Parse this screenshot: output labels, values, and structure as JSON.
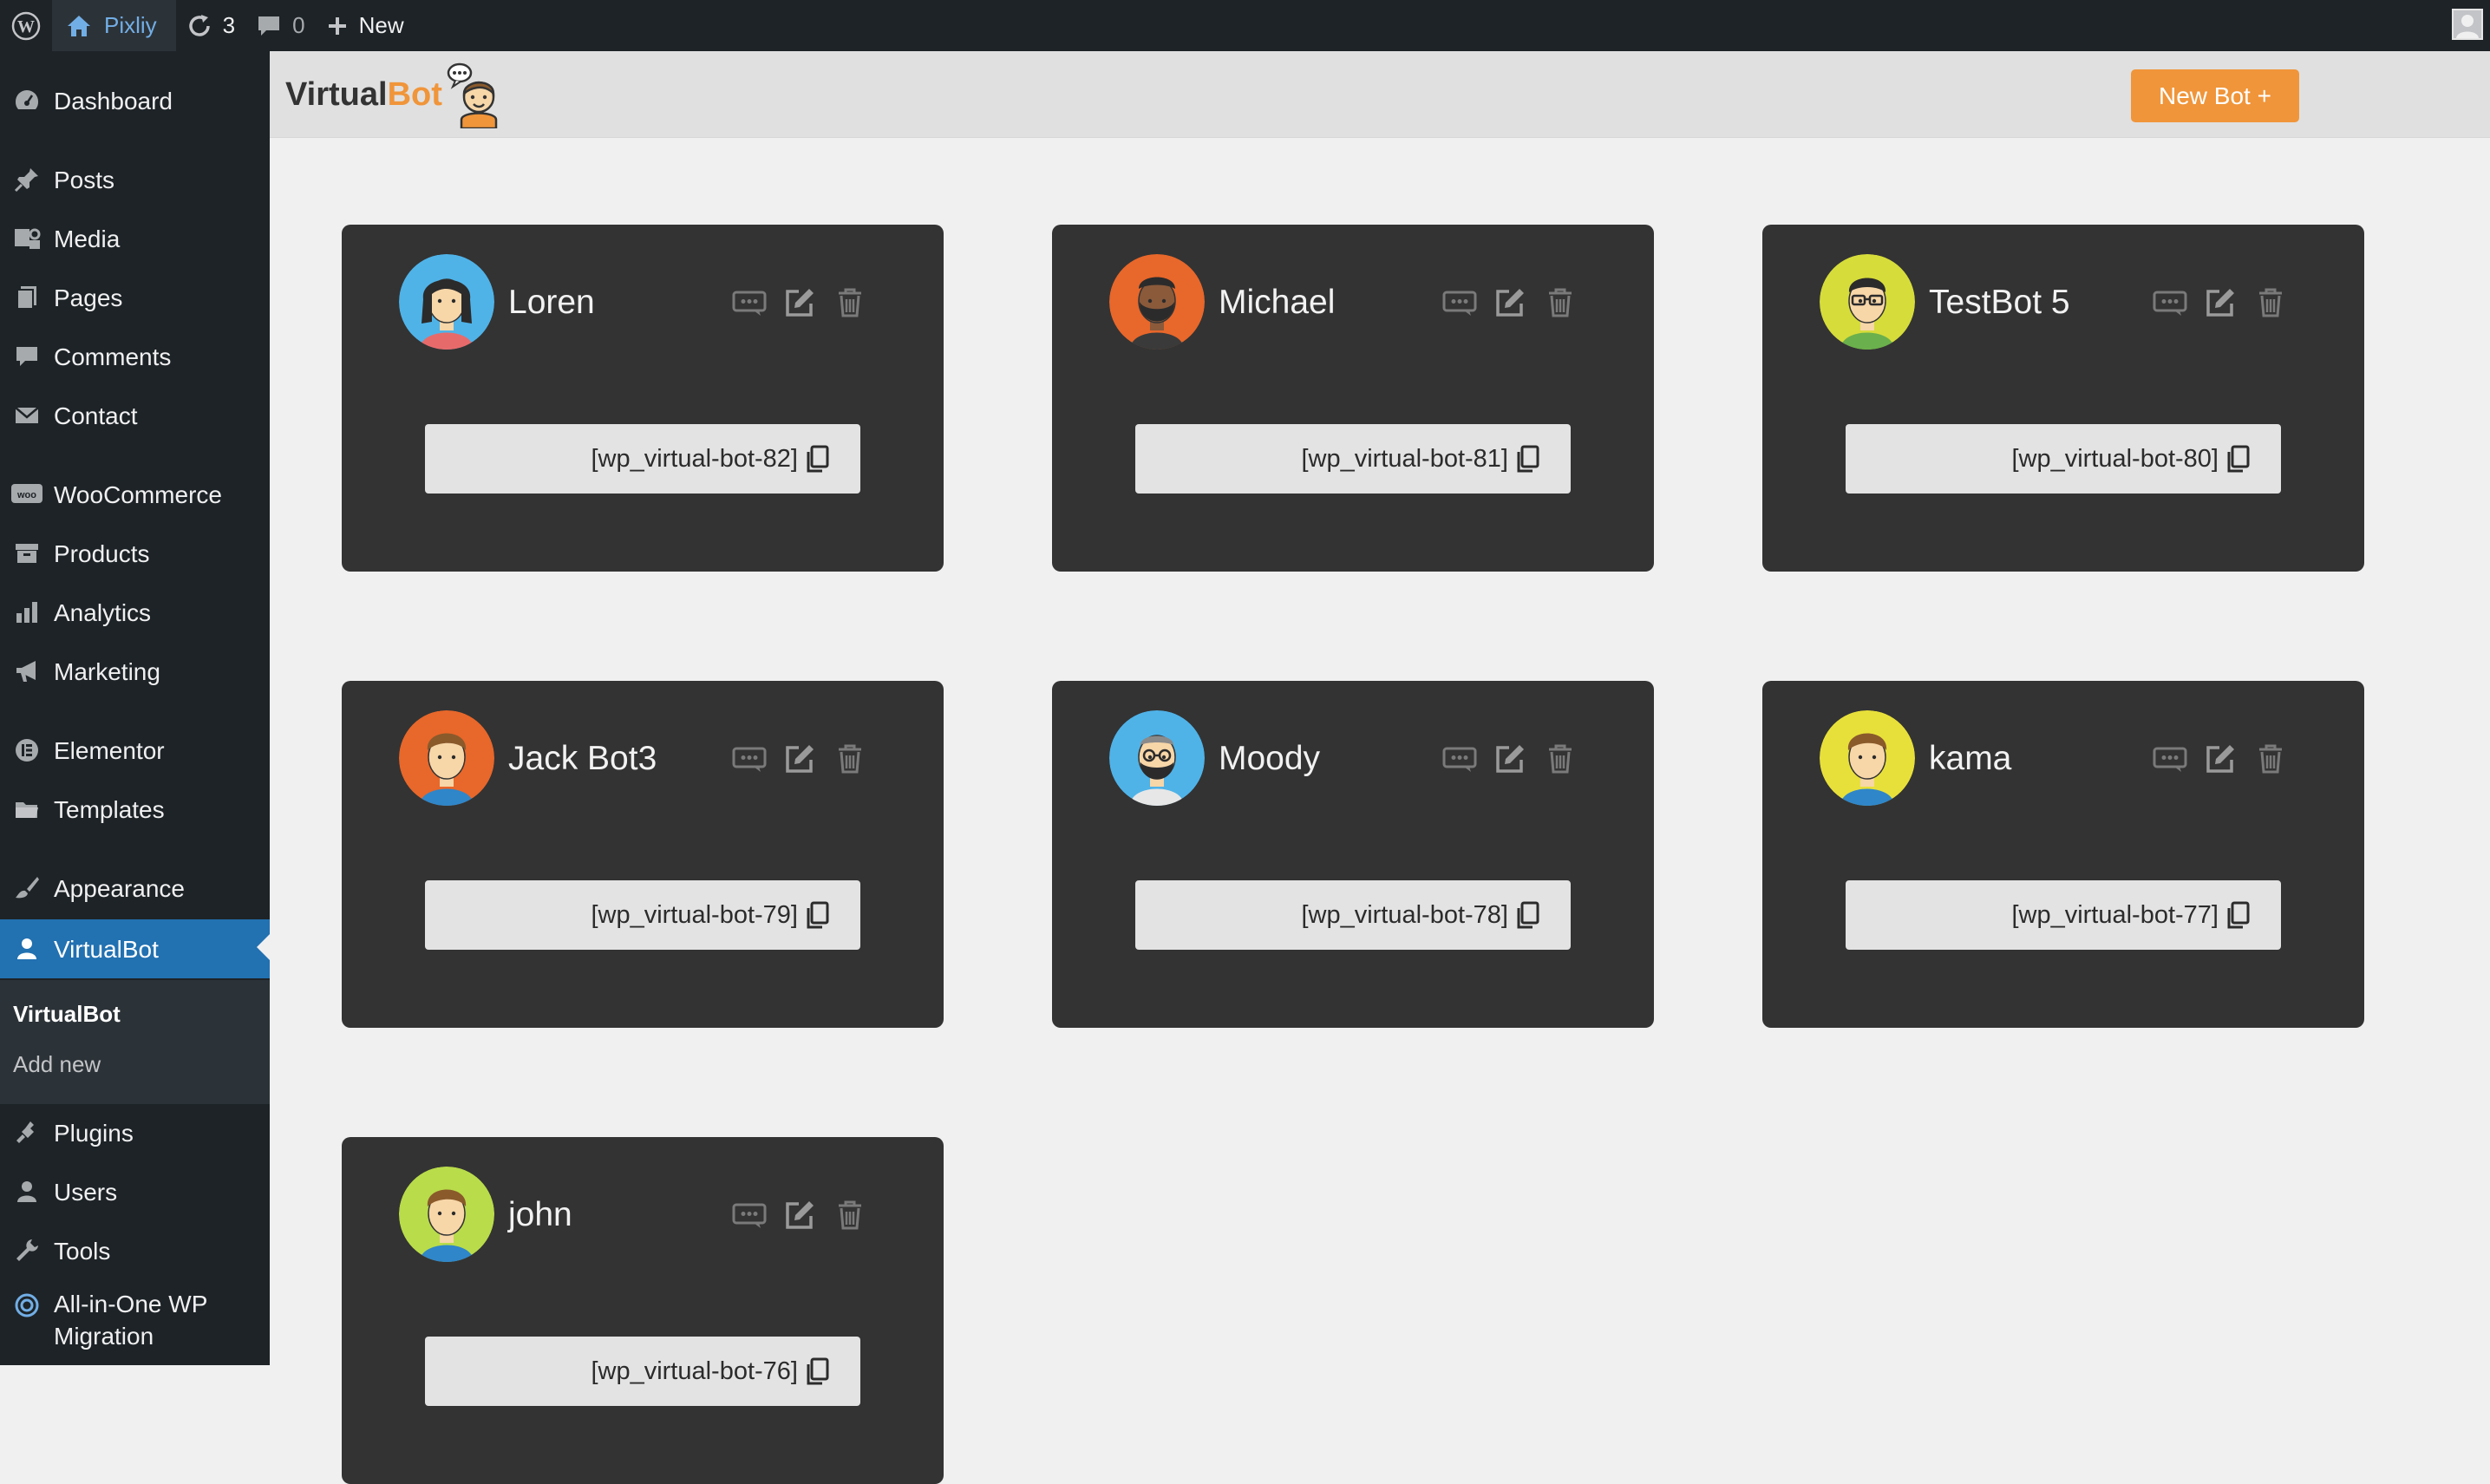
{
  "admin_bar": {
    "site_name": "Pixliy",
    "updates_count": "3",
    "comments_count": "0",
    "new_label": "New"
  },
  "sidebar": {
    "items": [
      {
        "label": "Dashboard",
        "icon": "dashboard-icon"
      },
      {
        "label": "Posts",
        "icon": "pin-icon"
      },
      {
        "label": "Media",
        "icon": "media-icon"
      },
      {
        "label": "Pages",
        "icon": "pages-icon"
      },
      {
        "label": "Comments",
        "icon": "comment-icon"
      },
      {
        "label": "Contact",
        "icon": "mail-icon"
      },
      {
        "label": "WooCommerce",
        "icon": "woo-icon"
      },
      {
        "label": "Products",
        "icon": "archive-icon"
      },
      {
        "label": "Analytics",
        "icon": "chart-icon"
      },
      {
        "label": "Marketing",
        "icon": "megaphone-icon"
      },
      {
        "label": "Elementor",
        "icon": "elementor-icon"
      },
      {
        "label": "Templates",
        "icon": "folder-icon"
      },
      {
        "label": "Appearance",
        "icon": "brush-icon"
      },
      {
        "label": "VirtualBot",
        "icon": "user-icon"
      },
      {
        "label": "Plugins",
        "icon": "plugin-icon"
      },
      {
        "label": "Users",
        "icon": "users-icon"
      },
      {
        "label": "Tools",
        "icon": "wrench-icon"
      },
      {
        "label": "All-in-One WP",
        "label2": "Migration",
        "icon": "migration-icon"
      }
    ],
    "submenu": {
      "current": "VirtualBot",
      "add_new": "Add new"
    }
  },
  "header": {
    "logo_part1": "Virtual",
    "logo_part2": "Bot",
    "new_bot_label": "New Bot +"
  },
  "bots": [
    {
      "name": "Loren",
      "shortcode": "[wp_virtual-bot-82]",
      "avatar_bg": "#4fb3e8",
      "avatar": "woman"
    },
    {
      "name": "Michael",
      "shortcode": "[wp_virtual-bot-81]",
      "avatar_bg": "#e8672a",
      "avatar": "beard-dark"
    },
    {
      "name": "TestBot 5",
      "shortcode": "[wp_virtual-bot-80]",
      "avatar_bg": "#d6dc3a",
      "avatar": "glasses"
    },
    {
      "name": "Jack Bot3",
      "shortcode": "[wp_virtual-bot-79]",
      "avatar_bg": "#e8672a",
      "avatar": "man"
    },
    {
      "name": "Moody",
      "shortcode": "[wp_virtual-bot-78]",
      "avatar_bg": "#4fb3e8",
      "avatar": "beard-glasses"
    },
    {
      "name": "kama",
      "shortcode": "[wp_virtual-bot-77]",
      "avatar_bg": "#e8e03a",
      "avatar": "man"
    },
    {
      "name": "john",
      "shortcode": "[wp_virtual-bot-76]",
      "avatar_bg": "#b9dc4a",
      "avatar": "man"
    }
  ],
  "colors": {
    "accent": "#f0953a",
    "admin_dark": "#1d2327",
    "wp_blue": "#2271b1",
    "card_bg": "#333333"
  }
}
